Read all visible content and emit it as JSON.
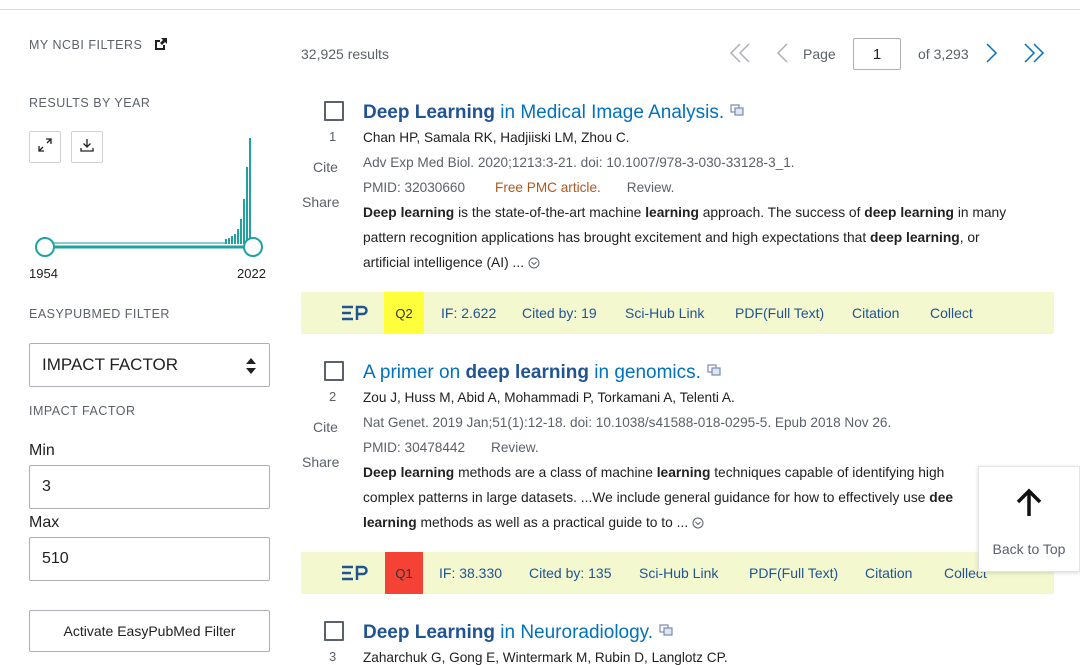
{
  "sidebar": {
    "my_ncbi_filters": "MY NCBI FILTERS",
    "results_by_year": "RESULTS BY YEAR",
    "year_start": "1954",
    "year_end": "2022",
    "easypubmed_filter": "EASYPUBMED FILTER",
    "select_value": "IMPACT FACTOR",
    "impact_factor_label": "IMPACT FACTOR",
    "min_label": "Min",
    "min_value": "3",
    "max_label": "Max",
    "max_value": "510",
    "activate_button": "Activate EasyPubMed Filter"
  },
  "results": {
    "count": "32,925 results",
    "page_label": "Page",
    "page_value": "1",
    "page_of": "of 3,293"
  },
  "articles": [
    {
      "number": "1",
      "cite": "Cite",
      "share": "Share",
      "title_bold": "Deep Learning",
      "title_rest": " in Medical Image Analysis.",
      "authors": "Chan HP, Samala RK, Hadjiiski LM, Zhou C.",
      "journal": "Adv Exp Med Biol. 2020;1213:3-21. doi: 10.1007/978-3-030-33128-3_1.",
      "pmid": "PMID: 32030660",
      "free": "Free PMC article.",
      "review": "Review.",
      "snippet": {
        "s1": "Deep learning",
        "s2": " is the state-of-the-art machine ",
        "s3": "learning",
        "s4": " approach. The success of ",
        "s5": "deep learning",
        "s6": " in many pattern recognition applications has brought excitement and high expectations that ",
        "s7": "deep learning",
        "s8": ", or artificial intelligence (AI) ..."
      },
      "ep": {
        "quartile": "Q2",
        "quartile_color": "#ffff3b",
        "if": "IF: 2.622",
        "cited": "Cited by: 19",
        "scihub": "Sci-Hub Link",
        "pdf": "PDF(Full Text)",
        "citation": "Citation",
        "collect": "Collect"
      }
    },
    {
      "number": "2",
      "cite": "Cite",
      "share": "Share",
      "title_pre": "A primer on ",
      "title_bold": "deep learning",
      "title_rest": " in genomics.",
      "authors": "Zou J, Huss M, Abid A, Mohammadi P, Torkamani A, Telenti A.",
      "journal": "Nat Genet. 2019 Jan;51(1):12-18. doi: 10.1038/s41588-018-0295-5. Epub 2018 Nov 26.",
      "pmid": "PMID: 30478442",
      "review": "Review.",
      "snippet": {
        "s1": "Deep learning",
        "s2": " methods are a class of machine ",
        "s3": "learning",
        "s4": " techniques capable of identifying high",
        "s5": "complex patterns in large datasets. ...We include general guidance for how to effectively use ",
        "s6": "dee",
        "s7": "learning",
        "s8": " methods as well as a practical guide to to ..."
      },
      "ep": {
        "quartile": "Q1",
        "quartile_color": "#f44336",
        "if": "IF: 38.330",
        "cited": "Cited by: 135",
        "scihub": "Sci-Hub Link",
        "pdf": "PDF(Full Text)",
        "citation": "Citation",
        "collect": "Collect"
      }
    },
    {
      "number": "3",
      "title_bold": "Deep Learning",
      "title_rest": " in Neuroradiology.",
      "authors": "Zaharchuk G, Gong E, Wintermark M, Rubin D, Langlotz CP."
    }
  ],
  "back_to_top": "Back to Top",
  "colors": {
    "link": "#0071bc",
    "link_bold": "#205493",
    "ep_bar": "#f4f8cf",
    "histogram": "#20a39e",
    "free_article": "#b0581d"
  }
}
